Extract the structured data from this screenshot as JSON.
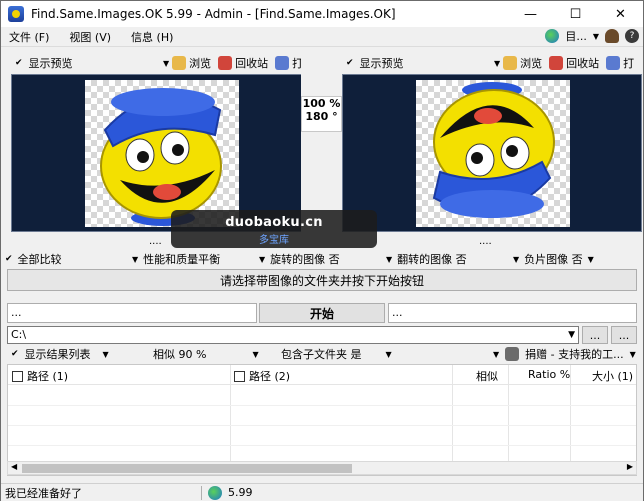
{
  "window": {
    "title": "Find.Same.Images.OK 5.99 - Admin - [Find.Same.Images.OK]",
    "controls": {
      "minimize": "—",
      "maximize": "☐",
      "close": "✕"
    }
  },
  "menubar": {
    "items": [
      "文件 (F)",
      "视图 (V)",
      "信息 (H)"
    ],
    "right_label": "目...",
    "right_icons": [
      "globe-icon",
      "person-icon",
      "help-icon"
    ]
  },
  "left_panel": {
    "header_label": "显示预览",
    "browse_label": "浏览",
    "recycle_label": "回收站",
    "open_label": "打"
  },
  "right_panel": {
    "header_label": "显示预览",
    "browse_label": "浏览",
    "recycle_label": "回收站",
    "open_label": "打"
  },
  "compare_info": {
    "similarity": "100 %",
    "rotation": "180 °"
  },
  "dots_left": "....",
  "dots_right": "....",
  "options": [
    {
      "label": "全部比较"
    },
    {
      "label": "性能和质量平衡"
    },
    {
      "label": "旋转的图像 否"
    },
    {
      "label": "翻转的图像 否"
    },
    {
      "label": "负片图像 否"
    }
  ],
  "message": "请选择带图像的文件夹并按下开始按钮",
  "progress": {
    "left_text": "...",
    "right_text": "...",
    "start_label": "开始"
  },
  "path": {
    "value": "C:\\",
    "browse_button": "...",
    "add_button": "..."
  },
  "results_bar": {
    "view_label": "显示结果列表",
    "similarity_label": "相似 90 %",
    "subfolder_label": "包含子文件夹 是",
    "donate_label": "捐赠 - 支持我的工..."
  },
  "table": {
    "columns": [
      "路径 (1)",
      "路径 (2)",
      "相似",
      "Ratio %",
      "大小 (1)"
    ]
  },
  "statusbar": {
    "status_text": "我已经准备好了",
    "version": "5.99"
  },
  "watermark": {
    "line1": "duobaoku.cn",
    "line2": "多宝库"
  },
  "colors": {
    "preview_bg": "#0f1f3a",
    "accent_blue": "#2b57d9",
    "smiley_yellow": "#f3e000"
  }
}
